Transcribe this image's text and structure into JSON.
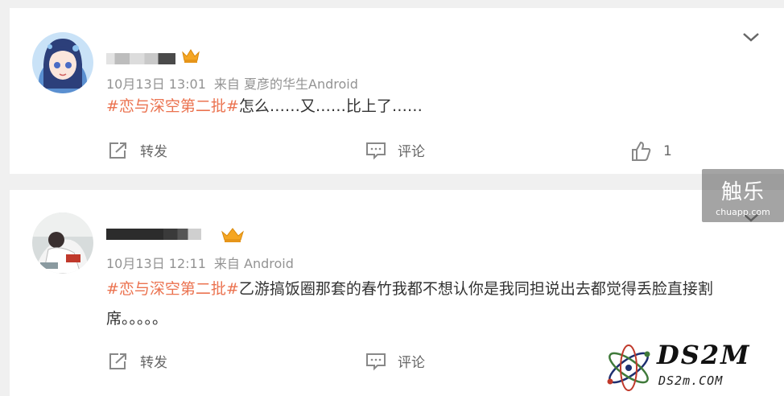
{
  "posts": [
    {
      "username_masked": "",
      "time": "10月13日 13:01",
      "source": "来自 夏彦的华生Android",
      "hashtag": "#恋与深空第二批#",
      "text": "怎么……又……比上了……",
      "actions": {
        "repost": "转发",
        "comment": "评论",
        "like_count": "1"
      }
    },
    {
      "username_masked": "",
      "time": "10月13日 12:11",
      "source": "来自 Android",
      "hashtag": "#恋与深空第二批#",
      "text": "乙游搞饭圈那套的春竹我都不想认你是我同担说出去都觉得丢脸直接割席。。。。。",
      "actions": {
        "repost": "转发",
        "comment": "评论"
      }
    }
  ],
  "watermarks": {
    "chuapp_big": "触乐",
    "chuapp_small": "chuapp.com",
    "ds2m_big": "DS2M",
    "ds2m_small": "DS2m.COM"
  },
  "colors": {
    "hashtag": "#eb7350",
    "meta": "#939393",
    "crown": "#f5a623"
  },
  "icons": [
    "avatar-anime-girl",
    "avatar-photo",
    "crown-icon",
    "chevron-down-icon",
    "repost-icon",
    "comment-icon",
    "like-icon"
  ]
}
